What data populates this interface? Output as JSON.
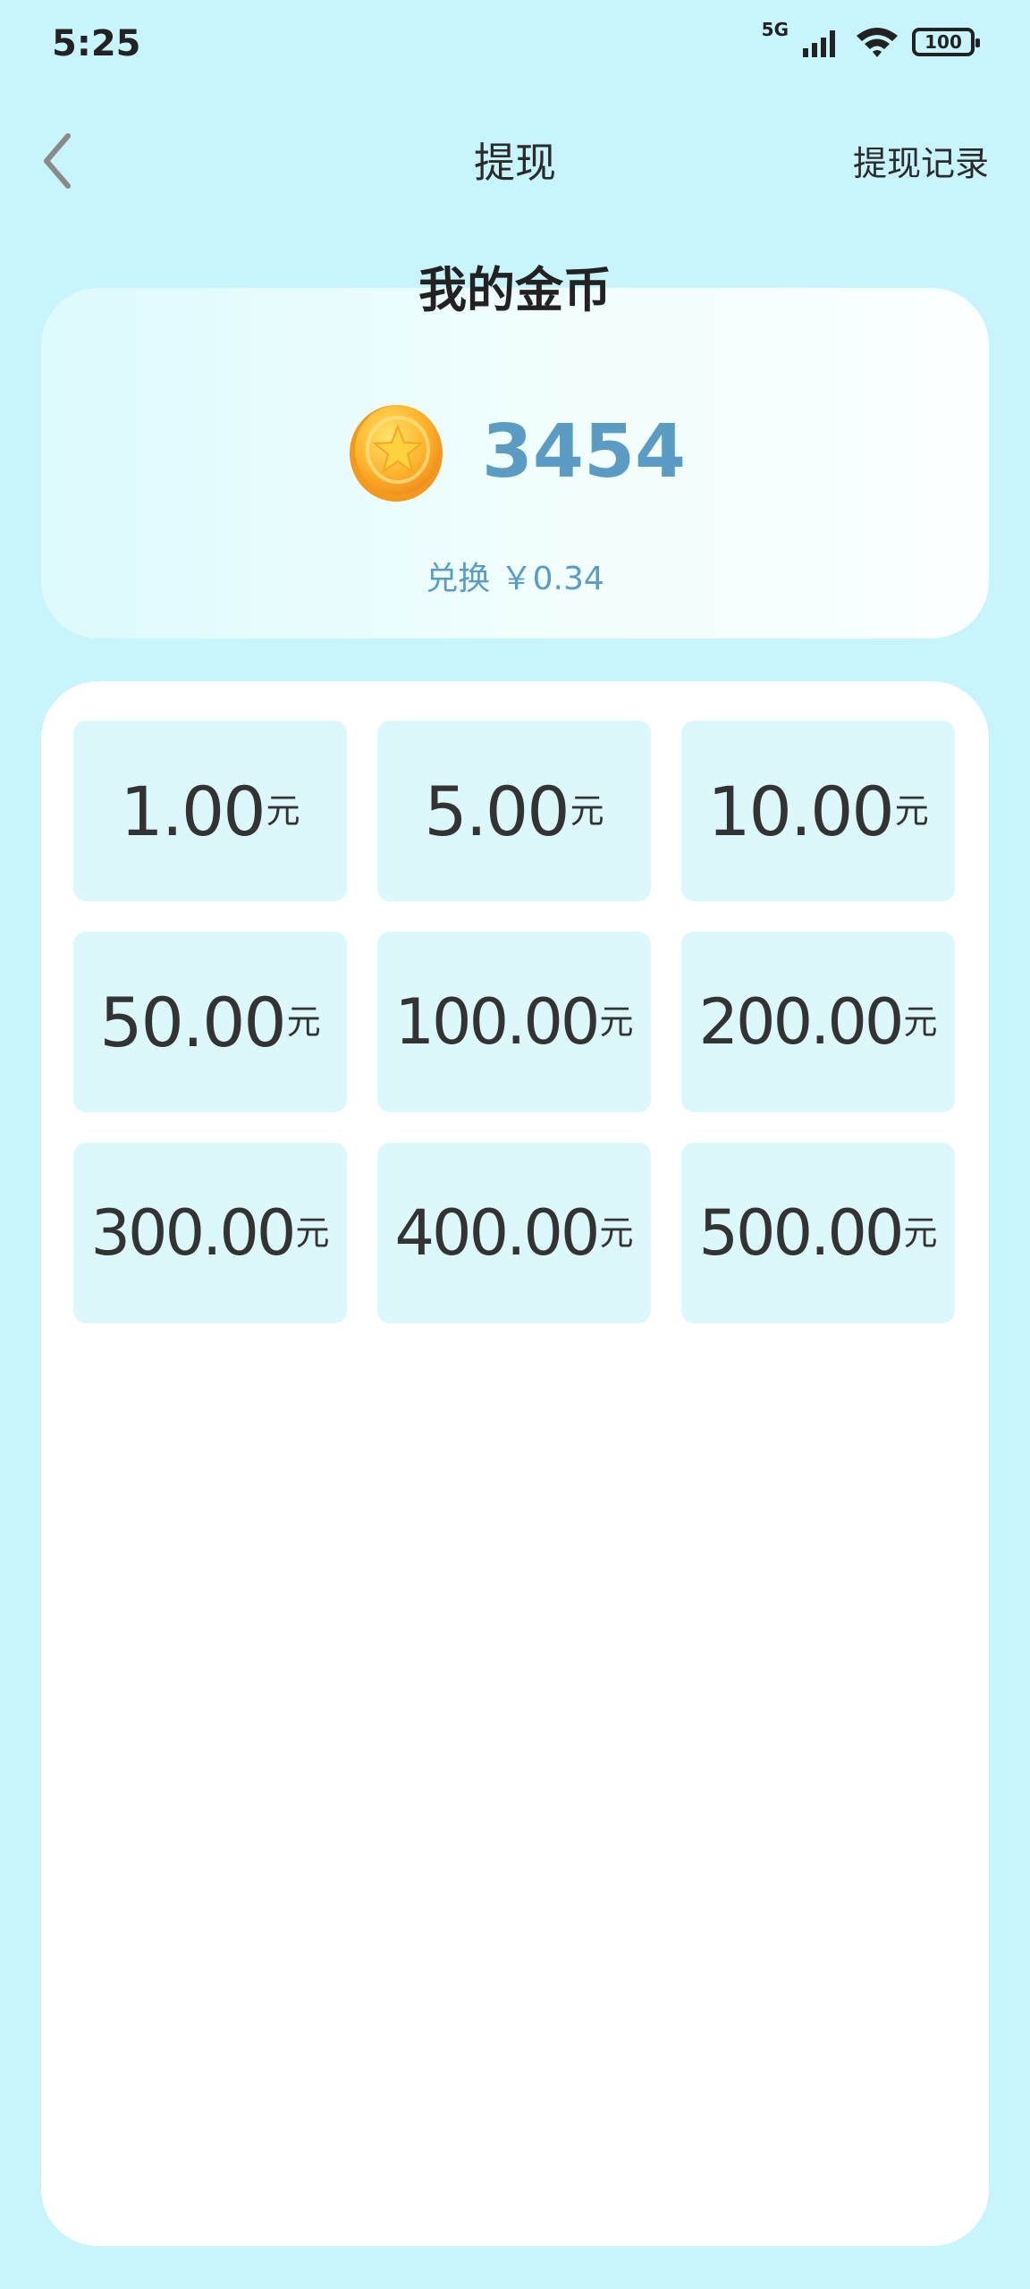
{
  "status_bar": {
    "time": "5:25",
    "network": "5G",
    "battery": "100"
  },
  "nav": {
    "title": "提现",
    "record_link": "提现记录"
  },
  "coins": {
    "title": "我的金币",
    "amount": "3454",
    "exchange_text": "兑换 ￥0.34"
  },
  "amounts": {
    "unit": "元",
    "options": [
      "1.00",
      "5.00",
      "10.00",
      "50.00",
      "100.00",
      "200.00",
      "300.00",
      "400.00",
      "500.00"
    ]
  },
  "colors": {
    "background": "#c8f4fc",
    "accent": "#5a9cc4",
    "tile": "#dcf8fa"
  }
}
